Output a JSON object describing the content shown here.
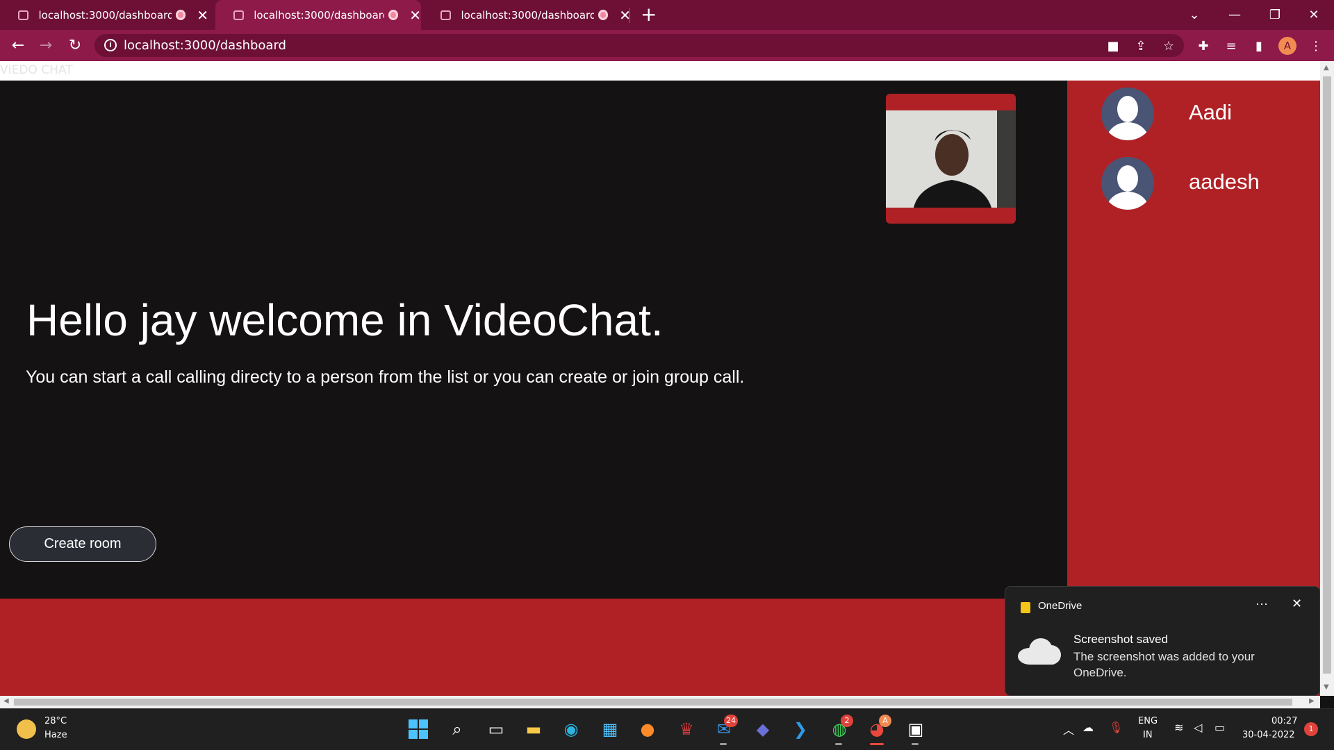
{
  "browser": {
    "tabs": [
      {
        "title": "localhost:3000/dashboard",
        "active": false
      },
      {
        "title": "localhost:3000/dashboard",
        "active": true
      },
      {
        "title": "localhost:3000/dashboard",
        "active": false
      }
    ],
    "url": "localhost:3000/dashboard",
    "profile_initial": "A",
    "theme_color": "#8d1a49"
  },
  "page": {
    "brand": "VIEDO CHAT",
    "welcome_title": "Hello jay welcome in VideoChat.",
    "welcome_subtitle": "You can start a call calling directy to a person from the list or you can create or join group call.",
    "create_room_label": "Create room",
    "accent_color": "#b02126",
    "background_color": "#141213"
  },
  "users": [
    {
      "name": "Aadi"
    },
    {
      "name": "aadesh"
    }
  ],
  "toast": {
    "app": "OneDrive",
    "title": "Screenshot saved",
    "message": "The screenshot was added to your OneDrive.",
    "more_label": "···",
    "close_label": "✕"
  },
  "taskbar": {
    "weather_temp": "28°C",
    "weather_desc": "Haze",
    "mail_badge": "24",
    "whatsapp_badge": "2",
    "chrome_badge": "A",
    "lang_line1": "ENG",
    "lang_line2": "IN",
    "time": "00:27",
    "date": "30-04-2022",
    "notification_count": "1"
  }
}
